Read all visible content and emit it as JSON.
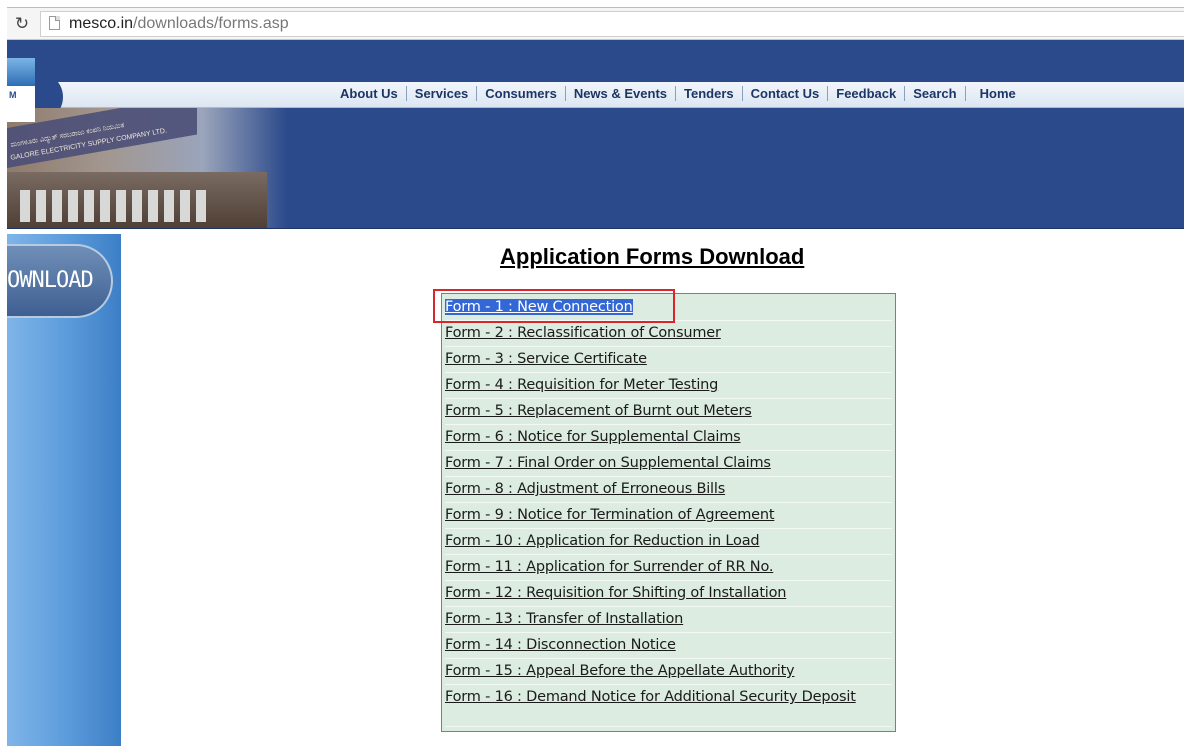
{
  "browser": {
    "url_host": "mesco.in",
    "url_path": "/downloads/forms.asp",
    "reload_icon": "reload-icon",
    "page_icon": "page-icon"
  },
  "header": {
    "logo_letter": "M",
    "banner_line1": "ಮಂಗಳೂರು ವಿದ್ಯುತ್ ಸರಬರಾಜು ಕಂಪನಿ ನಿಯಮಿತ",
    "banner_line2": "GALORE ELECTRICITY SUPPLY COMPANY LTD.",
    "nav": [
      "About Us",
      "Services",
      "Consumers",
      "News & Events",
      "Tenders",
      "Contact Us",
      "Feedback",
      "Search",
      "Home"
    ]
  },
  "sidebar": {
    "download_label": "OWNLOAD"
  },
  "main": {
    "title": "Application Forms Download",
    "forms": [
      "Form - 1 : New Connection",
      "Form - 2 : Reclassification of Consumer",
      "Form - 3 : Service Certificate",
      "Form - 4 : Requisition for Meter Testing",
      "Form - 5 : Replacement of Burnt out Meters",
      "Form - 6 : Notice for Supplemental Claims",
      "Form - 7 : Final Order on Supplemental Claims",
      "Form - 8 : Adjustment of Erroneous Bills",
      "Form - 9 : Notice for Termination of Agreement",
      "Form - 10 : Application for Reduction in Load",
      "Form - 11 : Application for Surrender of RR No.",
      "Form - 12 : Requisition for Shifting of Installation",
      "Form - 13 : Transfer of Installation",
      "Form - 14 : Disconnection Notice",
      "Form - 15 : Appeal Before the Appellate Authority",
      "Form - 16 : Demand Notice for Additional Security Deposit"
    ]
  },
  "colors": {
    "header_blue": "#2b4a8b",
    "forms_bg": "#dcece0",
    "selection": "#3367d6",
    "highlight_border": "#d9262c"
  }
}
